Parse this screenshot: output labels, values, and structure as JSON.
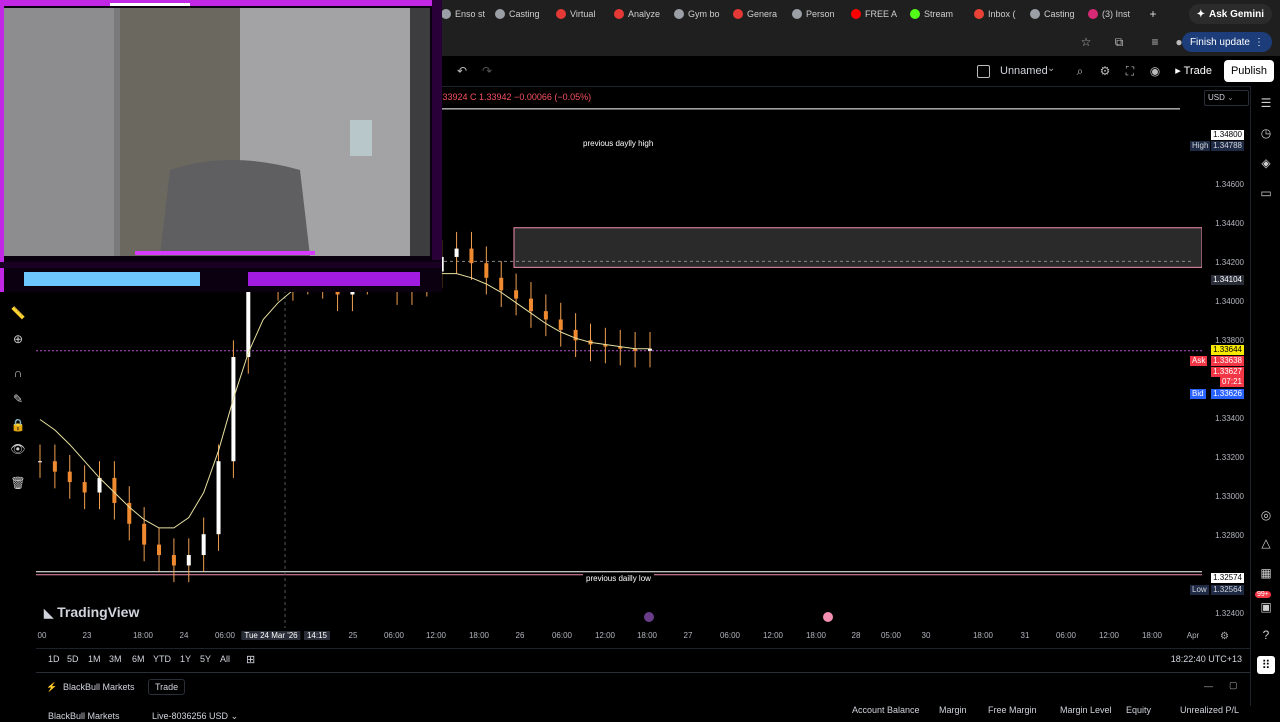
{
  "browser": {
    "tabs": [
      {
        "label": "Enso st",
        "color": "#9aa0a6"
      },
      {
        "label": "Casting",
        "color": "#9aa0a6"
      },
      {
        "label": "Virtual",
        "color": "#e53935"
      },
      {
        "label": "Analyze",
        "color": "#e53935"
      },
      {
        "label": "Gym bo",
        "color": "#9aa0a6"
      },
      {
        "label": "Genera",
        "color": "#e53935"
      },
      {
        "label": "Person",
        "color": "#9aa0a6"
      },
      {
        "label": "FREE A",
        "color": "#ff0000"
      },
      {
        "label": "Stream",
        "color": "#53fc18"
      },
      {
        "label": "Inbox (",
        "color": "#ea4335"
      },
      {
        "label": "Casting",
        "color": "#9aa0a6"
      },
      {
        "label": "(3) Inst",
        "color": "#d62976"
      }
    ],
    "new_tab": "+",
    "ask_gemini": "Ask Gemini",
    "finish_update": "Finish update"
  },
  "toolbar": {
    "layout_name": "Unnamed",
    "trade": "Trade",
    "publish": "Publish"
  },
  "legend": {
    "ohlc_text": ".33924  C 1.33942  −0.00066 (−0.05%)"
  },
  "price_axis": {
    "currency": "USD",
    "ticks": [
      "1.34600",
      "1.34400",
      "1.34200",
      "1.34000",
      "1.33800",
      "1.33400",
      "1.33200",
      "1.33000",
      "1.32800",
      "1.32400"
    ],
    "prev_high_label": "1.34800",
    "high": {
      "tag": "High",
      "value": "1.34788"
    },
    "crosshair_price": "1.34104",
    "last_price": "1.33644",
    "ask": {
      "tag": "Ask",
      "value": "1.33638"
    },
    "current": {
      "value": "1.33627",
      "countdown": "07:21"
    },
    "bid": {
      "tag": "Bid",
      "value": "1.33626"
    },
    "prev_low_label": "1.32574",
    "low": {
      "tag": "Low",
      "value": "1.32564"
    }
  },
  "annotations": {
    "prev_high": "previous daylly high",
    "prev_low": "previous dailly low"
  },
  "chart_data": {
    "type": "line",
    "ylim": [
      1.323,
      1.349
    ],
    "x_ticks": [
      "00",
      "23",
      "18:00",
      "24",
      "06:00",
      "Tue 24 Mar '26",
      "14:15",
      "25",
      "06:00",
      "12:00",
      "18:00",
      "26",
      "06:00",
      "12:00",
      "18:00",
      "27",
      "06:00",
      "12:00",
      "18:00",
      "28",
      "05:00",
      "30",
      "18:00",
      "31",
      "06:00",
      "12:00",
      "18:00",
      "Apr"
    ],
    "x_cursor_time": "14:15",
    "close_series": [
      1.331,
      1.3305,
      1.33,
      1.3295,
      1.3302,
      1.329,
      1.328,
      1.327,
      1.3265,
      1.326,
      1.3265,
      1.3275,
      1.331,
      1.336,
      1.34,
      1.3405,
      1.3395,
      1.3398,
      1.3402,
      1.3396,
      1.339,
      1.3398,
      1.3405,
      1.34,
      1.3393,
      1.3397,
      1.3401,
      1.3408,
      1.3412,
      1.3405,
      1.3398,
      1.3392,
      1.3388,
      1.3382,
      1.3378,
      1.3373,
      1.3368,
      1.3366,
      1.3365,
      1.3364,
      1.3363,
      1.3364
    ],
    "moving_average": [
      1.333,
      1.3325,
      1.3318,
      1.331,
      1.3302,
      1.3295,
      1.3288,
      1.3282,
      1.3278,
      1.3278,
      1.3283,
      1.3295,
      1.3315,
      1.334,
      1.3362,
      1.3378,
      1.3386,
      1.3392,
      1.3396,
      1.3398,
      1.3399,
      1.34,
      1.3401,
      1.3401,
      1.34,
      1.3399,
      1.3399,
      1.34,
      1.34,
      1.3398,
      1.3395,
      1.3391,
      1.3386,
      1.3381,
      1.3376,
      1.3372,
      1.3369,
      1.3367,
      1.3366,
      1.3365,
      1.3364,
      1.3364
    ],
    "levels": {
      "prev_high": 1.3479,
      "prev_low": 1.3257,
      "zone_top": 1.3422,
      "zone_bottom": 1.3403,
      "current": 1.3363
    }
  },
  "watermark": "TradingView",
  "ranges": [
    "1D",
    "5D",
    "1M",
    "3M",
    "6M",
    "YTD",
    "1Y",
    "5Y",
    "All"
  ],
  "clock": "18:22:40 UTC+13",
  "bottom_panel": {
    "broker": "BlackBull Markets",
    "trade_tab": "Trade",
    "account": "BlackBull Markets",
    "live_id": "Live-8036256 USD",
    "columns": [
      "Account Balance",
      "Margin",
      "Free Margin",
      "Margin Level",
      "Equity",
      "Unrealized P/L"
    ]
  },
  "notification_badge": "99+"
}
